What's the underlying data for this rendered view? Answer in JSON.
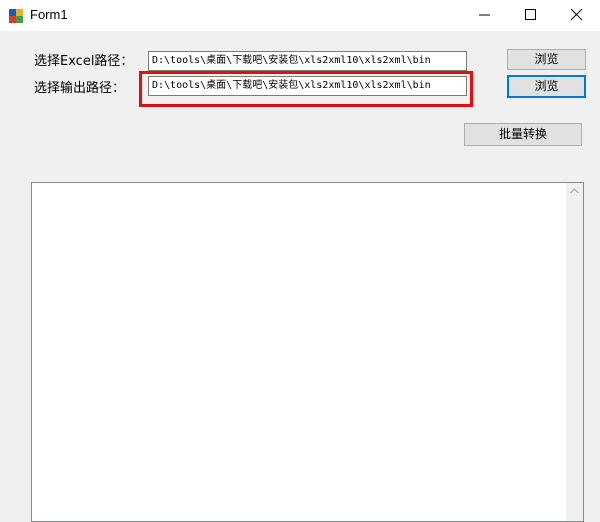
{
  "window": {
    "title": "Form1",
    "controls": {
      "minimize_icon": "minimize-icon",
      "maximize_icon": "maximize-icon",
      "close_icon": "close-icon"
    }
  },
  "form": {
    "excel_label": "选择Excel路径：",
    "excel_path": "D:\\tools\\桌面\\下载吧\\安装包\\xls2xml10\\xls2xml\\bin",
    "output_label": "选择输出路径：",
    "output_path": "D:\\tools\\桌面\\下载吧\\安装包\\xls2xml10\\xls2xml\\bin",
    "browse1_label": "浏览",
    "browse2_label": "浏览",
    "batch_label": "批量转换"
  },
  "log": {
    "text": ""
  },
  "colors": {
    "highlight": "#e01010",
    "focus_border": "#0078d7"
  }
}
